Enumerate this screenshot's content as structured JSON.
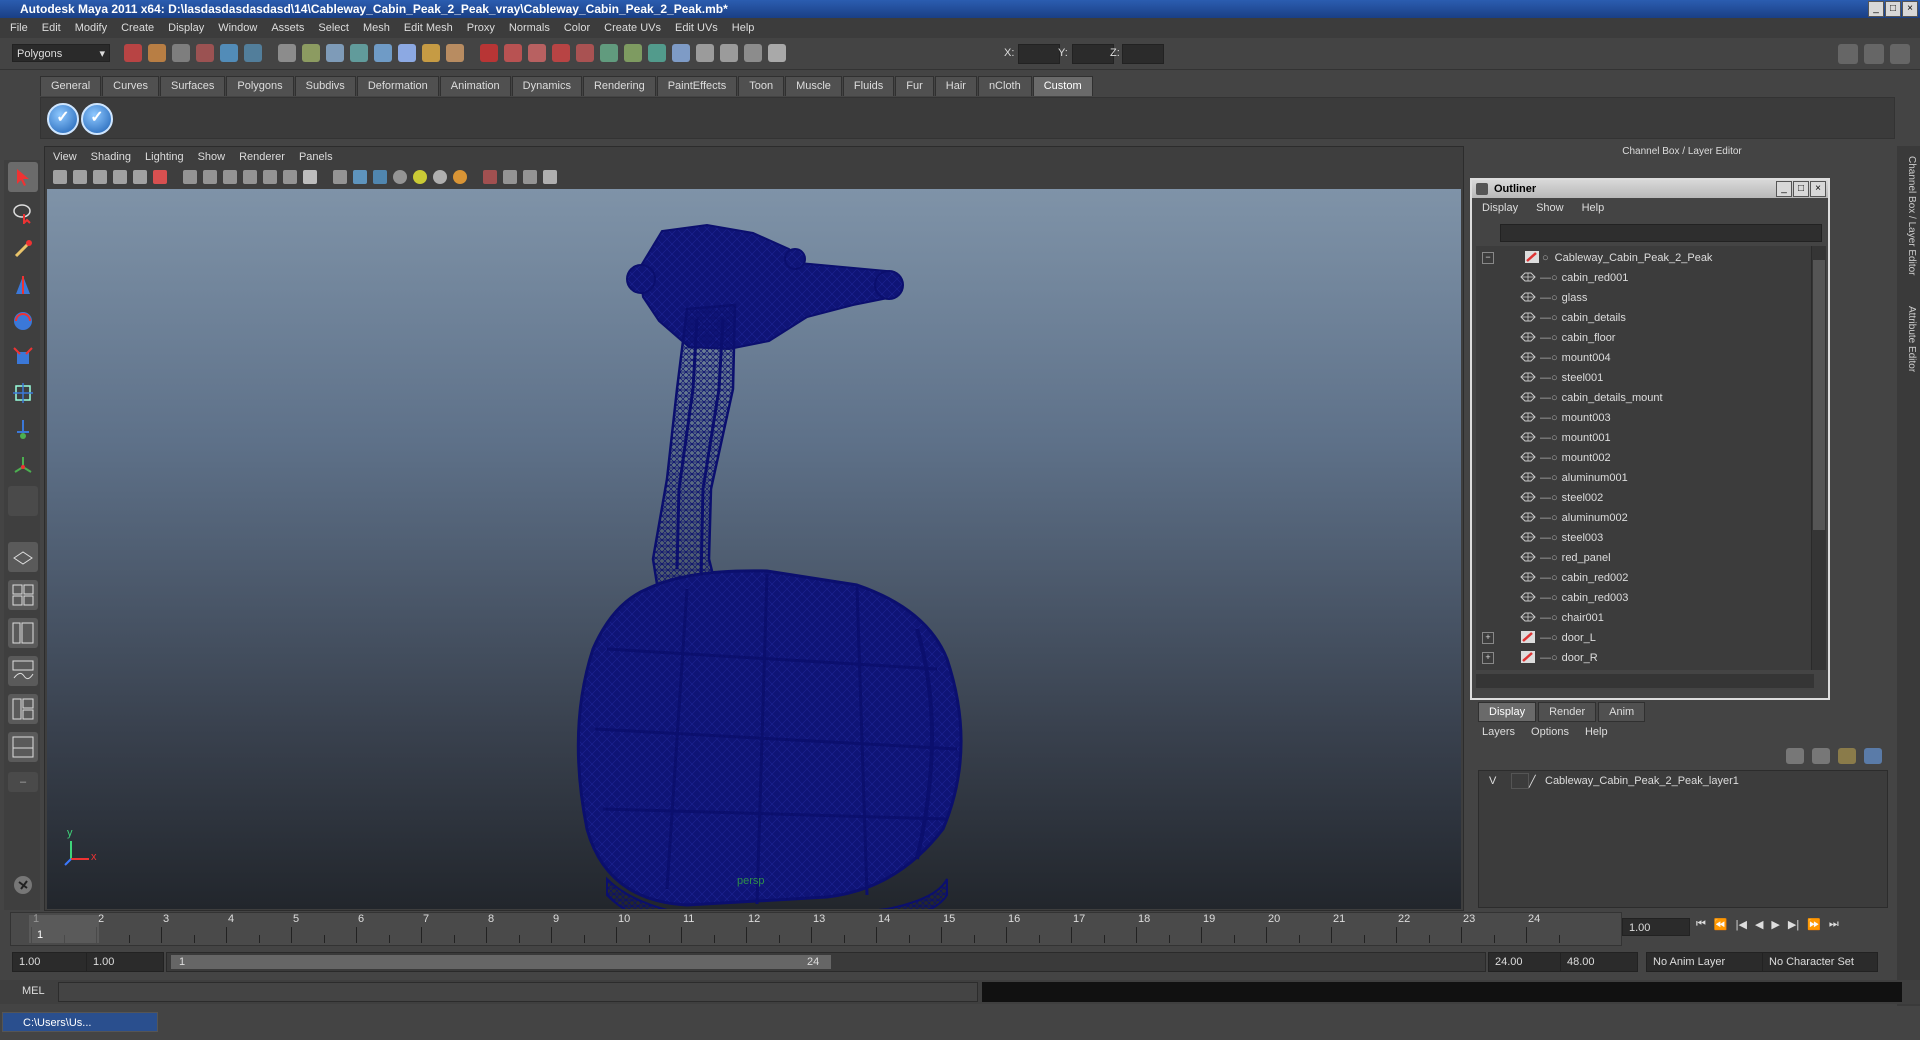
{
  "window": {
    "title": "Autodesk Maya 2011 x64: D:\\lasdasdasdasdasd\\14\\Cableway_Cabin_Peak_2_Peak_vray\\Cableway_Cabin_Peak_2_Peak.mb*"
  },
  "menubar": [
    "File",
    "Edit",
    "Modify",
    "Create",
    "Display",
    "Window",
    "Assets",
    "Select",
    "Mesh",
    "Edit Mesh",
    "Proxy",
    "Normals",
    "Color",
    "Create UVs",
    "Edit UVs",
    "Help"
  ],
  "statusline": {
    "menuset": "Polygons",
    "x_label": "X:",
    "y_label": "Y:",
    "z_label": "Z:"
  },
  "shelf": {
    "tabs": [
      "General",
      "Curves",
      "Surfaces",
      "Polygons",
      "Subdivs",
      "Deformation",
      "Animation",
      "Dynamics",
      "Rendering",
      "PaintEffects",
      "Toon",
      "Muscle",
      "Fluids",
      "Fur",
      "Hair",
      "nCloth",
      "Custom"
    ],
    "active_tab": "Custom"
  },
  "viewport": {
    "menu": [
      "View",
      "Shading",
      "Lighting",
      "Show",
      "Renderer",
      "Panels"
    ],
    "camera_label": "persp",
    "axis_y": "y",
    "axis_x": "x"
  },
  "channelbox": {
    "header": "Channel Box / Layer Editor"
  },
  "outliner": {
    "title": "Outliner",
    "menu": [
      "Display",
      "Show",
      "Help"
    ],
    "root": "Cableway_Cabin_Peak_2_Peak",
    "items": [
      "cabin_red001",
      "glass",
      "cabin_details",
      "cabin_floor",
      "mount004",
      "steel001",
      "cabin_details_mount",
      "mount003",
      "mount001",
      "mount002",
      "aluminum001",
      "steel002",
      "aluminum002",
      "steel003",
      "red_panel",
      "cabin_red002",
      "cabin_red003",
      "chair001",
      "door_L",
      "door_R"
    ],
    "expand_symbol": "+",
    "collapse_symbol": "−"
  },
  "layer_editor": {
    "tabs": [
      "Display",
      "Render",
      "Anim"
    ],
    "active_tab": "Display",
    "menu": [
      "Layers",
      "Options",
      "Help"
    ],
    "layer_visibility": "V",
    "layer_name": "Cableway_Cabin_Peak_2_Peak_layer1"
  },
  "right_tabs": [
    "Channel Box / Layer Editor",
    "Attribute Editor"
  ],
  "timeline": {
    "ticks": [
      "1",
      "2",
      "3",
      "4",
      "5",
      "6",
      "7",
      "8",
      "9",
      "10",
      "11",
      "12",
      "13",
      "14",
      "15",
      "16",
      "17",
      "18",
      "19",
      "20",
      "21",
      "22",
      "23",
      "24"
    ],
    "current_frame": "1.00",
    "current_marker": "1"
  },
  "range": {
    "start": "1.00",
    "anim_start": "1.00",
    "slider_start": "1",
    "slider_end": "24",
    "end": "24.00",
    "anim_end": "48.00",
    "anim_layer": "No Anim Layer",
    "character_set": "No Character Set"
  },
  "mel": {
    "label": "MEL"
  },
  "taskbar": {
    "item": "C:\\Users\\Us..."
  },
  "colors": {
    "wire": "#0b0f6e",
    "title_blue": "#1f4b9a",
    "accent": "#2a78d8"
  }
}
